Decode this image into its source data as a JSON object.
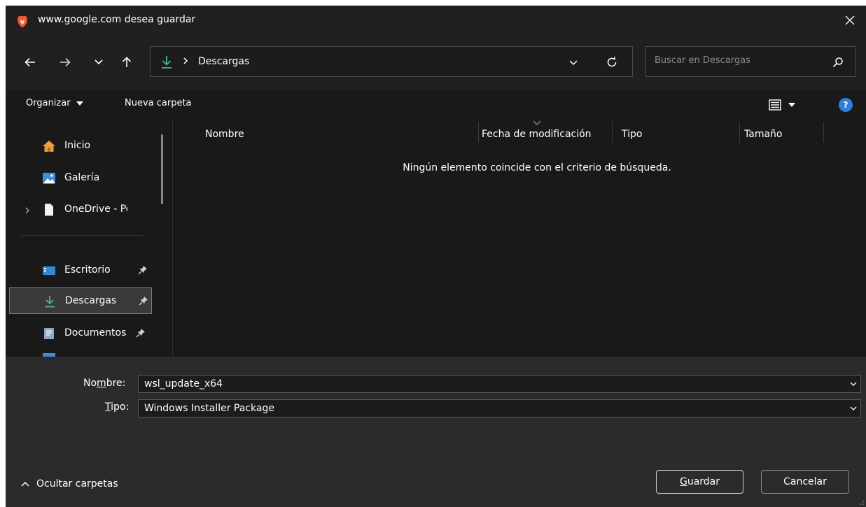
{
  "window": {
    "title": "www.google.com desea guardar",
    "close_icon": "close-icon"
  },
  "navigation": {
    "back_icon": "arrow-left-icon",
    "forward_icon": "arrow-right-icon",
    "recent_icon": "chevron-down-icon",
    "up_icon": "arrow-up-icon"
  },
  "address_bar": {
    "path": "Descargas",
    "refresh_icon": "refresh-icon"
  },
  "search": {
    "placeholder": "Buscar en Descargas"
  },
  "toolbar": {
    "organize_label": "Organizar",
    "new_folder_label": "Nueva carpeta",
    "help_label": "?"
  },
  "nav_pane": {
    "items": [
      {
        "label": "Inicio",
        "icon": "home-icon"
      },
      {
        "label": "Galería",
        "icon": "gallery-icon"
      },
      {
        "label": "OneDrive - Pers",
        "icon": "document-icon"
      },
      {
        "label": "Escritorio",
        "icon": "desktop-icon"
      },
      {
        "label": "Descargas",
        "icon": "download-icon"
      },
      {
        "label": "Documentos",
        "icon": "documents-icon"
      }
    ]
  },
  "file_list": {
    "columns": [
      "Nombre",
      "Fecha de modificación",
      "Tipo",
      "Tamaño"
    ],
    "empty_message": "Ningún elemento coincide con el criterio de búsqueda."
  },
  "form": {
    "name_label_pre": "No",
    "name_label_u": "m",
    "name_label_post": "bre:",
    "name_value": "wsl_update_x64",
    "type_label_u": "T",
    "type_label_post": "ipo:",
    "type_value": "Windows Installer Package"
  },
  "footer": {
    "hide_folders_label": "Ocultar carpetas",
    "save_u": "G",
    "save_post": "uardar",
    "cancel_label": "Cancelar"
  }
}
